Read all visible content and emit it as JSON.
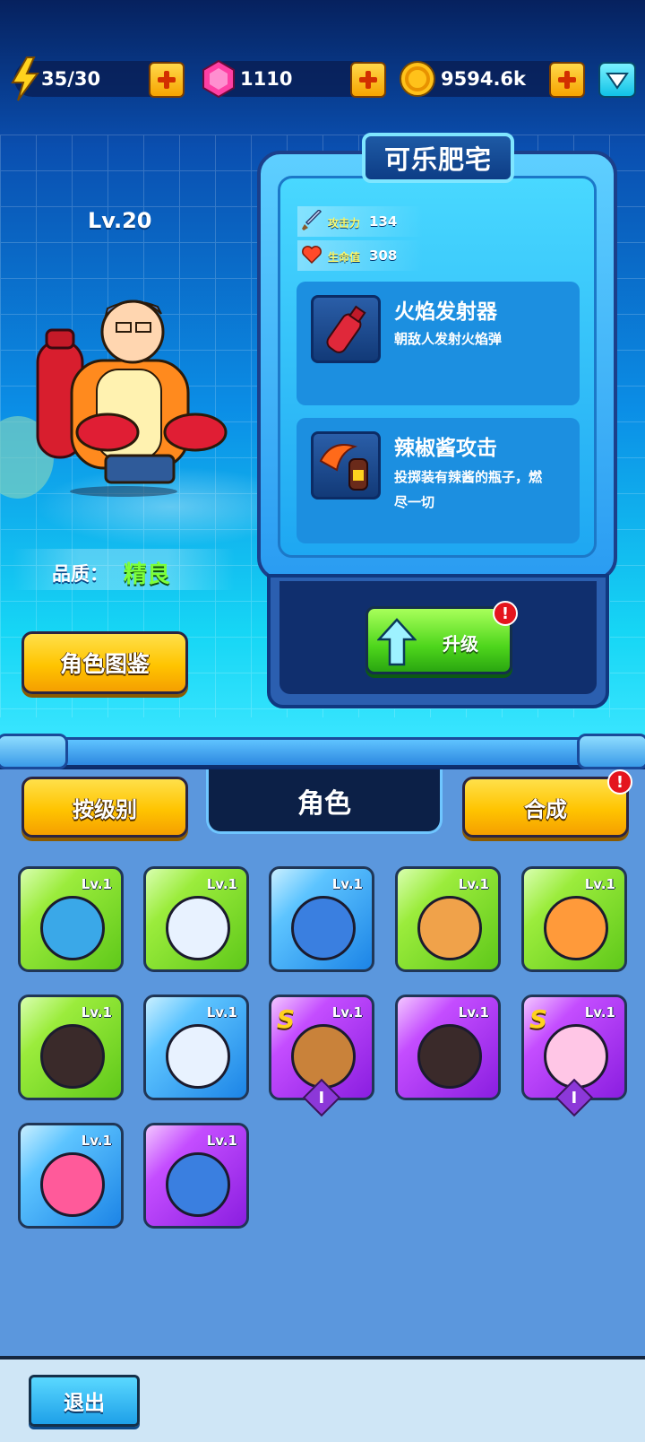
{
  "resources": {
    "energy": {
      "icon": "lightning-icon",
      "value": "35/30"
    },
    "gems": {
      "icon": "gem-icon",
      "value": "1110"
    },
    "coins": {
      "icon": "coin-icon",
      "value": "9594.6k"
    }
  },
  "character": {
    "level": "Lv.20",
    "name": "可乐肥宅",
    "quality_label": "品质：",
    "quality_value": "精良",
    "stats": [
      {
        "icon": "sword-icon",
        "label": "攻击力",
        "value": "134"
      },
      {
        "icon": "heart-icon",
        "label": "生命值",
        "value": "308"
      }
    ],
    "skills": [
      {
        "icon": "cola-bottle-icon",
        "name": "火焰发射器",
        "desc_line1": "朝敌人发射火焰弹",
        "desc_line2": ""
      },
      {
        "icon": "hot-sauce-bottle-icon",
        "name": "辣椒酱攻击",
        "desc_line1": "投掷装有辣酱的瓶子，燃",
        "desc_line2": "尽一切"
      }
    ]
  },
  "buttons": {
    "gallery": "角色图鉴",
    "upgrade": "升级",
    "sort": "按级别",
    "roles_tab": "角色",
    "synthesize": "合成",
    "exit": "退出",
    "alert_mark": "!"
  },
  "heroes": [
    {
      "level": "Lv.1",
      "rarity": "green",
      "icon": "blue-monster-icon",
      "face": "#3aa8e8"
    },
    {
      "level": "Lv.1",
      "rarity": "green",
      "icon": "white-hair-headset-icon",
      "face": "#e8f2ff"
    },
    {
      "level": "Lv.1",
      "rarity": "blue",
      "icon": "blue-hood-icon",
      "face": "#3a7fe0"
    },
    {
      "level": "Lv.1",
      "rarity": "green",
      "icon": "blonde-beard-man-icon",
      "face": "#f0a24a"
    },
    {
      "level": "Lv.1",
      "rarity": "green",
      "icon": "orange-bun-girl-icon",
      "face": "#ff9a3a"
    },
    {
      "level": "Lv.1",
      "rarity": "green",
      "icon": "black-beard-man-icon",
      "face": "#3a2a2a"
    },
    {
      "level": "Lv.1",
      "rarity": "blue",
      "icon": "white-hair-headset-icon",
      "face": "#e8f2ff"
    },
    {
      "level": "Lv.1",
      "rarity": "purple",
      "icon": "lion-icon",
      "face": "#c9823a",
      "badge": "S",
      "roman": "I"
    },
    {
      "level": "Lv.1",
      "rarity": "purple",
      "icon": "black-beard-man-icon",
      "face": "#3a2a2a"
    },
    {
      "level": "Lv.1",
      "rarity": "purple",
      "icon": "pink-hair-girl-icon",
      "face": "#ffc6e6",
      "badge": "S",
      "roman": "I"
    },
    {
      "level": "Lv.1",
      "rarity": "blue",
      "icon": "pink-goggles-girl-icon",
      "face": "#ff5a9a"
    },
    {
      "level": "Lv.1",
      "rarity": "purple",
      "icon": "blue-hood-icon",
      "face": "#3a7fe0"
    }
  ]
}
